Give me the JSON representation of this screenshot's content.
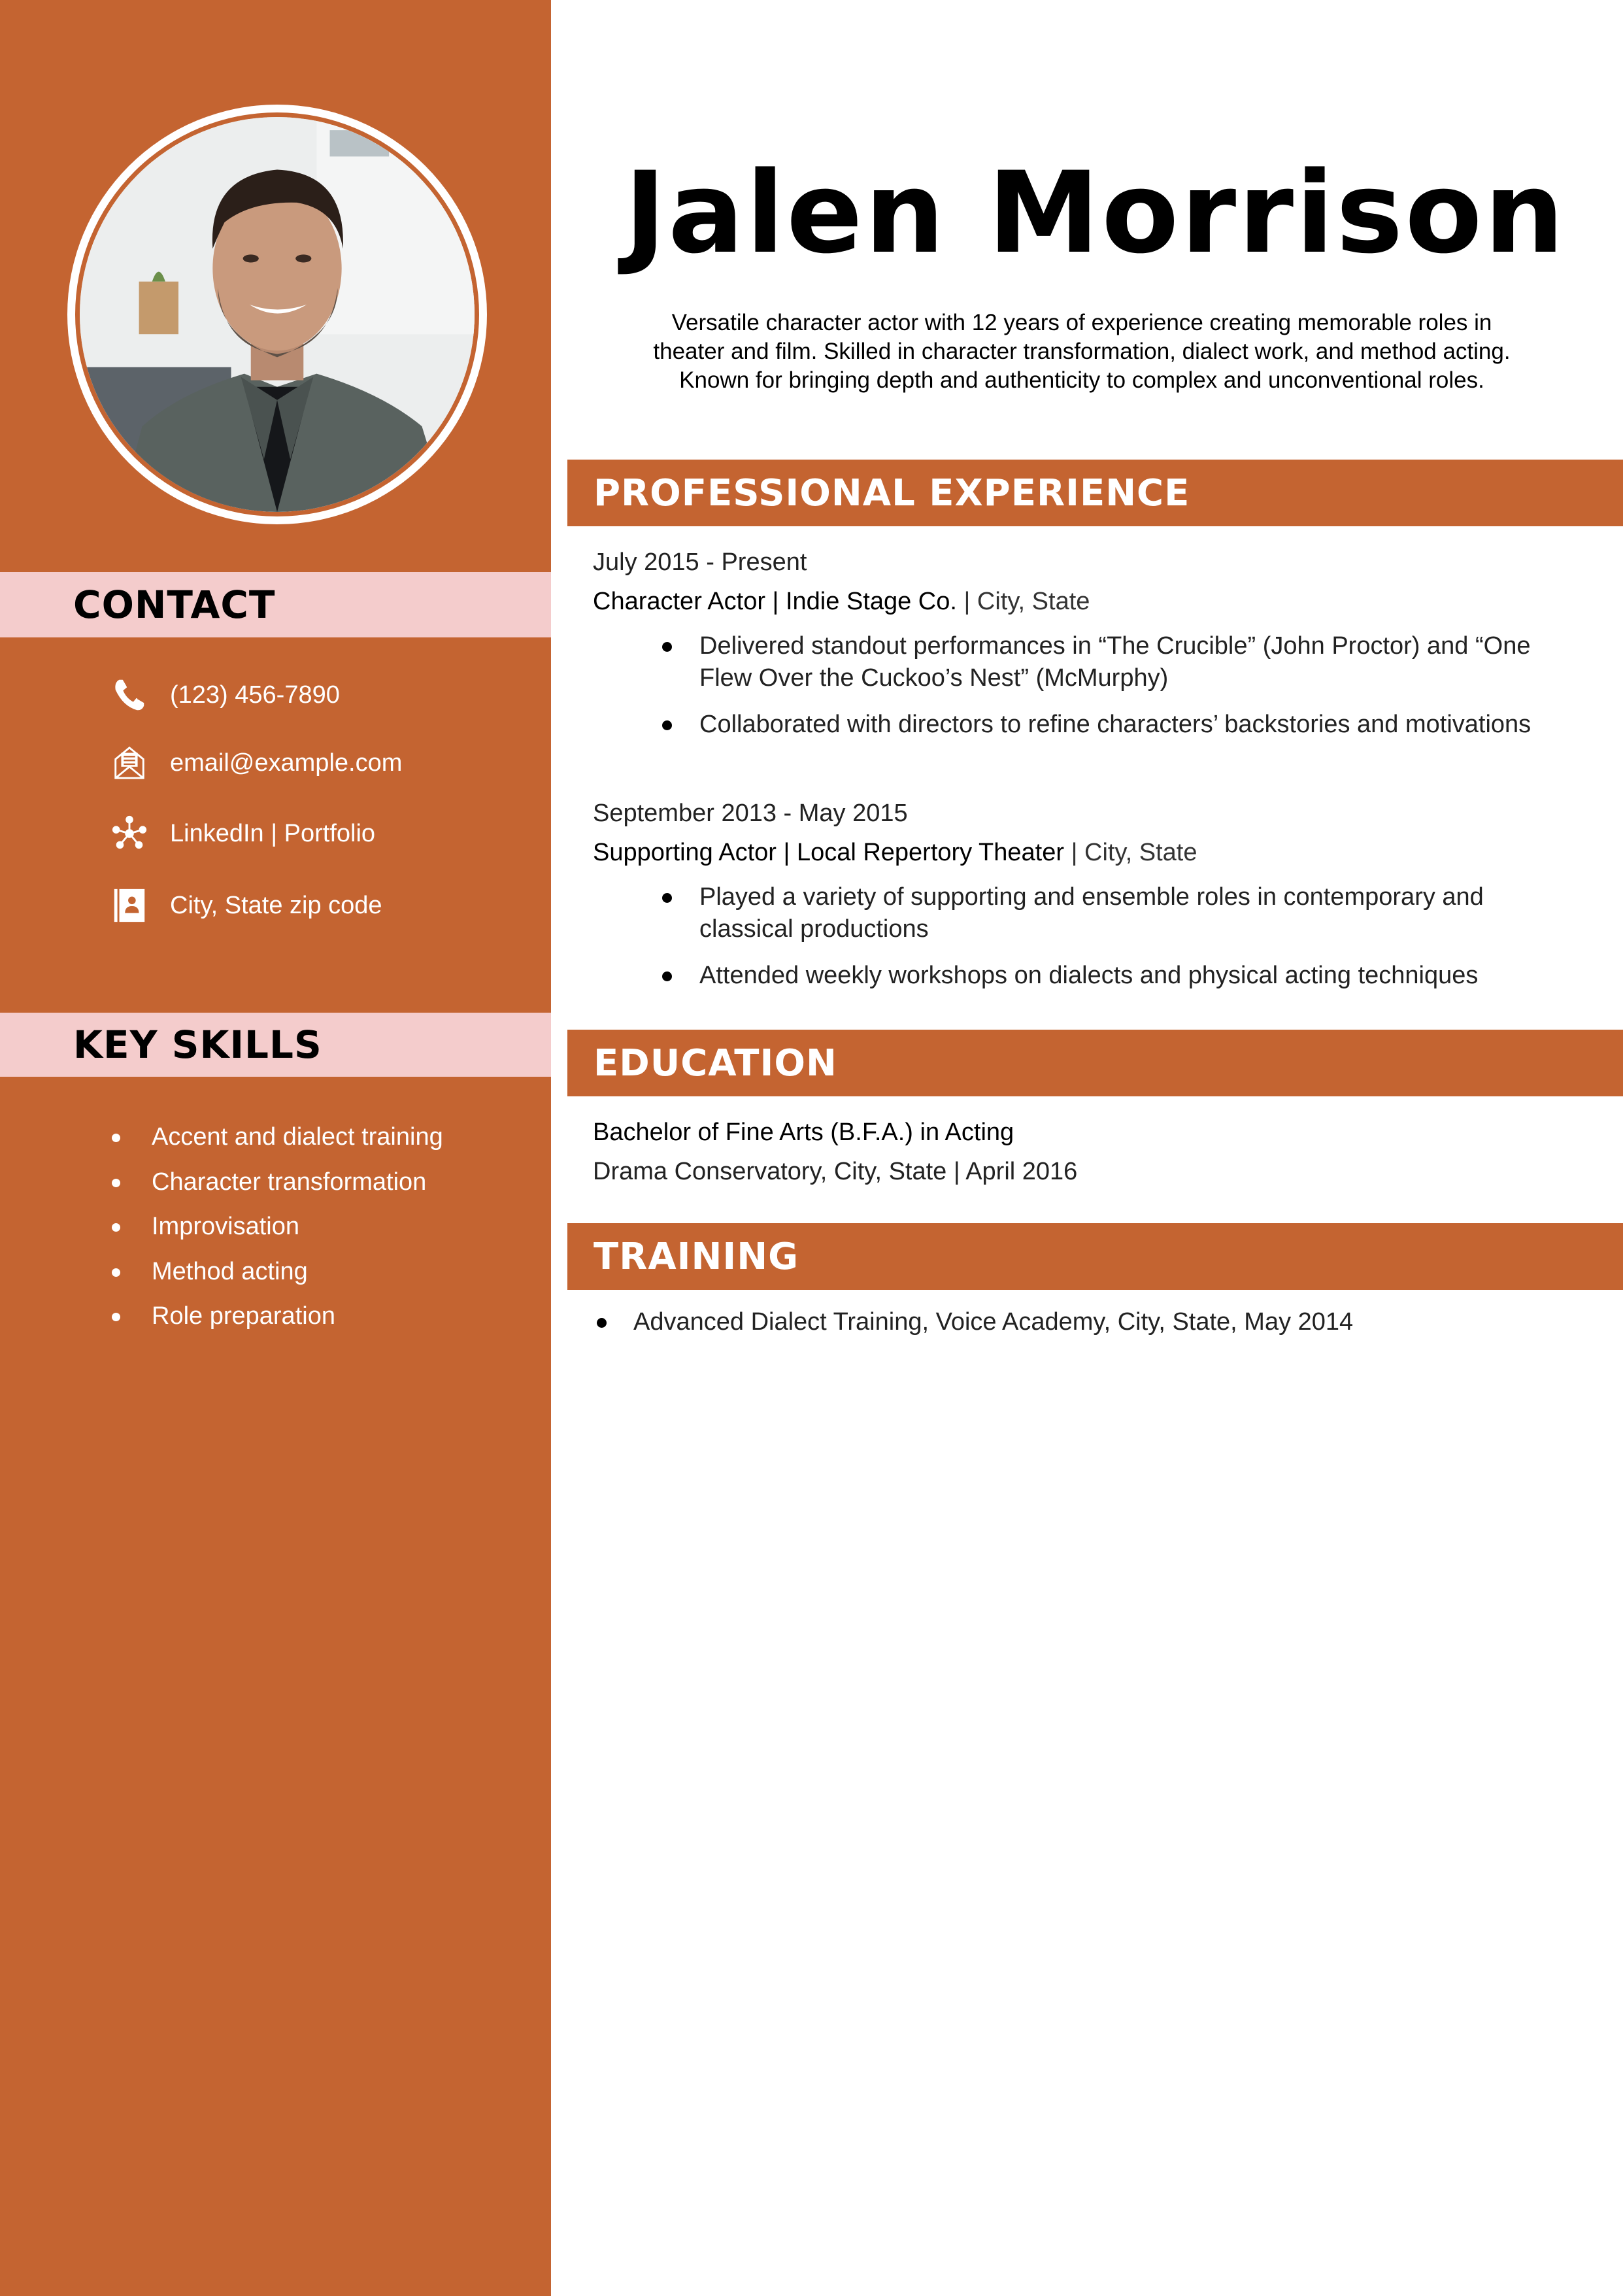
{
  "theme": {
    "accent": "#c46431",
    "sidebar_header_bg": "#f4cccc",
    "text": "#111111",
    "sidebar_text": "#ffffff"
  },
  "profile": {
    "photo_alt": "Portrait of Jalen Morrison",
    "name": "Jalen Morrison",
    "summary": "Versatile character actor with 12 years of experience creating memorable roles in theater and film. Skilled in character transformation, dialect work, and method acting. Known for bringing depth and authenticity to complex and unconventional roles."
  },
  "sidebar": {
    "contact": {
      "heading": "CONTACT",
      "items": [
        {
          "icon": "phone-icon",
          "text": "(123) 456-7890"
        },
        {
          "icon": "email-icon",
          "text": "email@example.com"
        },
        {
          "icon": "network-icon",
          "text": "LinkedIn | Portfolio"
        },
        {
          "icon": "address-book-icon",
          "text": "City, State zip code"
        }
      ]
    },
    "skills": {
      "heading": "KEY SKILLS",
      "items": [
        "Accent and dialect training",
        "Character transformation",
        "Improvisation",
        "Method acting",
        "Role preparation"
      ]
    }
  },
  "experience": {
    "heading": "PROFESSIONAL EXPERIENCE",
    "jobs": [
      {
        "dates": "July 2015 - Present",
        "title_company": "Character Actor | Indie Stage Co.",
        "location": " | City, State",
        "bullets": [
          "Delivered standout performances in “The Crucible” (John Proctor) and “One Flew Over the Cuckoo’s Nest” (McMurphy)",
          "Collaborated with directors to refine characters’ backstories and motivations"
        ]
      },
      {
        "dates": "September 2013 - May 2015",
        "title_company": "Supporting Actor | Local Repertory Theater",
        "location": " | City, State",
        "bullets": [
          "Played a variety of supporting and ensemble roles in contemporary and classical productions",
          "Attended weekly workshops on dialects and physical acting techniques"
        ]
      }
    ]
  },
  "education": {
    "heading": "EDUCATION",
    "degree": "Bachelor of Fine Arts (B.F.A.) in Acting",
    "school": "Drama Conservatory, City, State | April 2016"
  },
  "training": {
    "heading": "TRAINING",
    "items": [
      "Advanced Dialect Training, Voice Academy, City, State, May 2014"
    ]
  }
}
